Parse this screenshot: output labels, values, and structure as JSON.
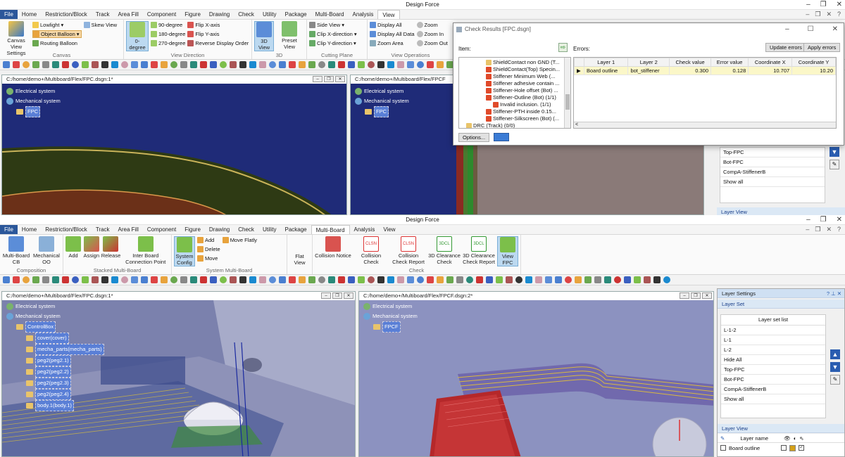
{
  "top": {
    "title": "Design Force",
    "menu": [
      "File",
      "Home",
      "Restriction/Block",
      "Track",
      "Area Fill",
      "Component",
      "Figure",
      "Drawing",
      "Check",
      "Utility",
      "Package",
      "Multi-Board",
      "Analysis",
      "View"
    ],
    "active_tab": "View",
    "ribbon": {
      "canvas_view_settings": "Canvas View Settings",
      "lowlight": "Lowlight",
      "skew_view": "Skew View",
      "object_balloon": "Object Balloon",
      "routing_balloon": "Routing Balloon",
      "group_canvas": "Canvas",
      "zero_degree": "0-degree",
      "deg90": "90-degree",
      "deg180": "180-degree",
      "deg270": "270-degree",
      "flip_x": "Flip X-axis",
      "flip_y": "Flip Y-axis",
      "reverse_order": "Reverse Display Order",
      "group_view_direction": "View Direction",
      "view_3d": "3D View",
      "preset_view": "Preset View",
      "group_3d": "3D",
      "side_view": "Side View",
      "clip_x": "Clip X-direction",
      "clip_y": "Clip Y-direction",
      "group_cutting_plane": "Cutting Plane",
      "display_all": "Display All",
      "display_all_data": "Display All Data",
      "zoom_area": "Zoom Area",
      "zoom": "Zoom",
      "zoom_in": "Zoom In",
      "zoom_out": "Zoom Out",
      "group_view_ops": "View Operations"
    },
    "doc_left": {
      "title": "C:/home/demo+/Multiboard/Flex/FPC.dsgn:1*",
      "tree": [
        "Electrical system",
        "Mechanical system",
        "FPC"
      ]
    },
    "doc_right": {
      "title": "C:/home/demo+/Multiboard/Flex/FPCF",
      "tree": [
        "Electrical system",
        "Mechanical system",
        "FPC"
      ]
    },
    "layer_list": [
      "Top-FPC",
      "Bot-FPC",
      "CompA-StiffenerB",
      "Show all"
    ],
    "layer_view_label": "Layer View"
  },
  "dialog": {
    "title": "Check Results [FPC.dsgn]",
    "item_label": "Item:",
    "errors_label": "Errors:",
    "update_errors": "Update errors",
    "apply_errors": "Apply errors",
    "options": "Options...",
    "items": [
      "ShieldContact non GND (T...",
      "ShieldContact(Top) Specin...",
      "Stiffener Minimum Web (...",
      "Stiffener adhesive contain ...",
      "Stiffener-Hole offset (Bot) ...",
      "Stiffener-Outline (Bot) (1/1)",
      "Invalid inclusion. (1/1)",
      "Stiffener-PTH inside 0.15...",
      "Stiffener-Silkscreen (Bot) (...",
      "DRC (Track) (0/0)"
    ],
    "columns": [
      "Layer 1",
      "Layer 2",
      "Check value",
      "Error value",
      "Coordinate X",
      "Coordinate Y"
    ],
    "rows": [
      [
        "Board outline",
        "bot_stiffener",
        "0.300",
        "0.128",
        "10.707",
        "10.20"
      ]
    ]
  },
  "bottom": {
    "title": "Design Force",
    "menu": [
      "File",
      "Home",
      "Restriction/Block",
      "Track",
      "Area Fill",
      "Component",
      "Figure",
      "Drawing",
      "Check",
      "Utility",
      "Package",
      "Multi-Board",
      "Analysis",
      "View"
    ],
    "active_tab": "Multi-Board",
    "ribbon": {
      "mb_cb": "Multi-Board CB",
      "mech_oo": "Mechanical OO",
      "group_composition": "Composition",
      "add": "Add",
      "assign": "Assign",
      "release": "Release",
      "inter_board": "Inter Board Connection Point",
      "group_stacked": "Stacked Multi-Board",
      "system_config": "System Config",
      "sm_add": "Add",
      "sm_delete": "Delete",
      "sm_move": "Move",
      "move_flatly": "Move Flatly",
      "group_system": "System Multi-Board",
      "flat_view": "Flat View",
      "collision_notice": "Collision Notice",
      "collision_check": "Collision Check",
      "collision_report": "Collision Check Report",
      "clearance_check": "3D Clearance Check",
      "clearance_report": "3D Clearance Check Report",
      "view_fpc": "View FPC",
      "group_check": "Check"
    },
    "doc_left": {
      "title": "C:/home/demo+/Multiboard/Flex/FPC.dsgn:1*",
      "tree": [
        "Electrical system",
        "Mechanical system",
        "ControlBox",
        "cover(cover)",
        "mecha_parts(mecha_parts)",
        "peg2(peg2.1)",
        "peg2(peg2.2)",
        "peg2(peg2.3)",
        "peg2(peg2.4)",
        "body.1(body.1)"
      ]
    },
    "doc_right": {
      "title": "C:/home/demo+/Multiboard/Flex/FPCF.dsgn:2*",
      "tree": [
        "Electrical system",
        "Mechanical system",
        "FPCF"
      ]
    },
    "layer_settings": "Layer Settings",
    "layer_set": "Layer Set",
    "layer_set_list": "Layer set list",
    "layer_sets": [
      "L-1-2",
      "L-1",
      "L-2",
      "Hide All",
      "Top-FPC",
      "Bot-FPC",
      "CompA-StiffenerB",
      "Show all"
    ],
    "layer_view": "Layer View",
    "layer_name_header": "Layer name",
    "layers": [
      "Board outline"
    ]
  }
}
